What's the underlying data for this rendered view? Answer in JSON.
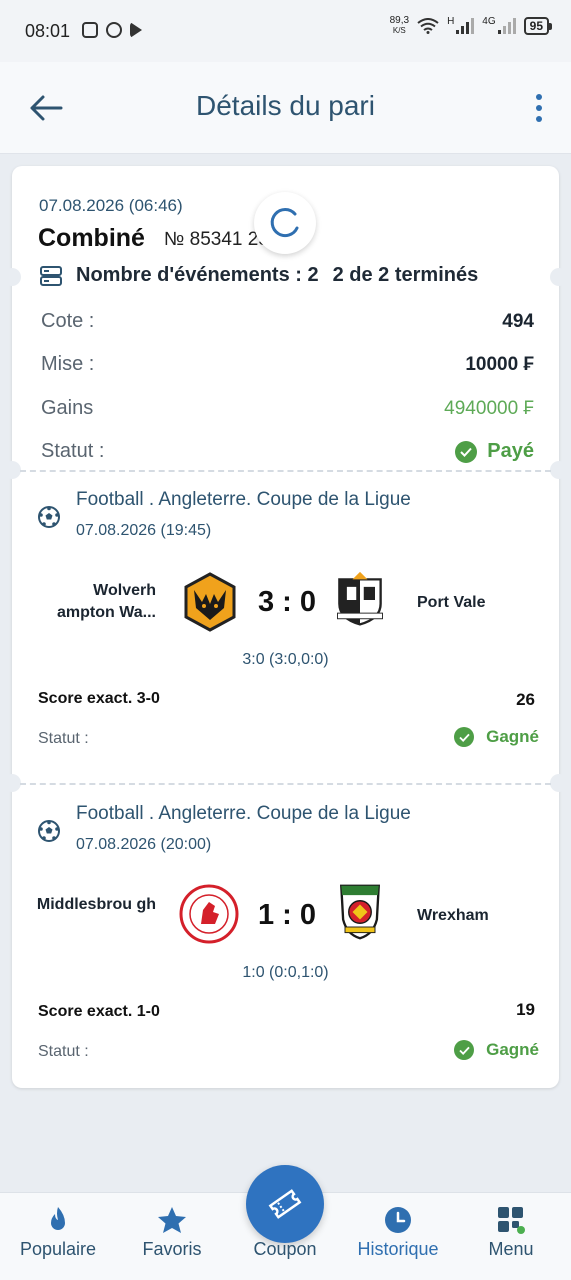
{
  "status_bar": {
    "time": "08:01",
    "speed_value": "89,3",
    "speed_unit": "K/S",
    "network_h": "H",
    "network_4g": "4G",
    "battery": "95"
  },
  "header": {
    "title": "Détails du pari",
    "back_icon": "arrow-left-icon",
    "more_icon": "more-vertical-icon"
  },
  "bet": {
    "date": "07.08.2026 (06:46)",
    "type": "Combiné",
    "number": "№ 85341        25",
    "events_label": "Nombre d'événements : 2",
    "events_done": "2 de 2 terminés",
    "rows": [
      {
        "label": "Cote :",
        "value": "494"
      },
      {
        "label": "Mise :",
        "value": "10000 ₣"
      },
      {
        "label": "Gains",
        "value": "4940000 ₣"
      }
    ],
    "status_label": "Statut :",
    "status_value": "Payé"
  },
  "events": [
    {
      "league": "Football . Angleterre. Coupe de la Ligue",
      "date": "07.08.2026 (19:45)",
      "home": "Wolverh ampton Wa...",
      "away": "Port Vale",
      "score": "3 : 0",
      "halves": "3:0 (3:0,0:0)",
      "bet_name": "Score exact. 3-0",
      "odd": "26",
      "status_label": "Statut :",
      "status": "Gagné"
    },
    {
      "league": "Football . Angleterre. Coupe de la Ligue",
      "date": "07.08.2026 (20:00)",
      "home": "Middlesbrou gh",
      "away": "Wrexham",
      "score": "1 : 0",
      "halves": "1:0 (0:0,1:0)",
      "bet_name": "Score exact. 1-0",
      "odd": "19",
      "status_label": "Statut :",
      "status": "Gagné"
    }
  ],
  "nav": [
    {
      "label": "Populaire",
      "icon": "flame-icon"
    },
    {
      "label": "Favoris",
      "icon": "star-icon"
    },
    {
      "label": "Coupon",
      "icon": "ticket-icon"
    },
    {
      "label": "Historique",
      "icon": "clock-icon"
    },
    {
      "label": "Menu",
      "icon": "grid-menu-icon"
    }
  ],
  "colors": {
    "accent": "#2f73c0",
    "title": "#2e5470",
    "success": "#4e9e46"
  }
}
